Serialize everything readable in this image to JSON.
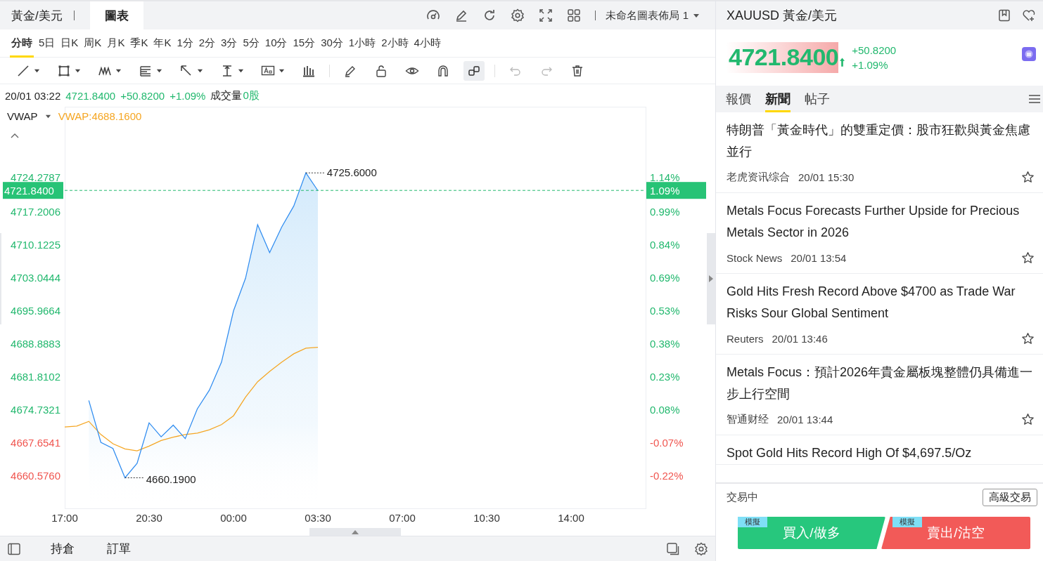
{
  "left_panel": {
    "tabs": [
      {
        "label": "黃金/美元",
        "selected": false
      },
      {
        "label": "圖表",
        "selected": true
      }
    ],
    "layout_menu": {
      "label": "未命名圖表佈局 1"
    },
    "periods": [
      {
        "label": "分時",
        "selected": true
      },
      {
        "label": "5日",
        "selected": false
      },
      {
        "label": "日K",
        "selected": false
      },
      {
        "label": "周K",
        "selected": false
      },
      {
        "label": "月K",
        "selected": false
      },
      {
        "label": "季K",
        "selected": false
      },
      {
        "label": "年K",
        "selected": false
      },
      {
        "label": "1分",
        "selected": false
      },
      {
        "label": "2分",
        "selected": false
      },
      {
        "label": "3分",
        "selected": false
      },
      {
        "label": "5分",
        "selected": false
      },
      {
        "label": "10分",
        "selected": false
      },
      {
        "label": "15分",
        "selected": false
      },
      {
        "label": "30分",
        "selected": false
      },
      {
        "label": "1小時",
        "selected": false
      },
      {
        "label": "2小時",
        "selected": false
      },
      {
        "label": "4小時",
        "selected": false
      }
    ],
    "info_bar": {
      "datetime": "20/01 03:22",
      "price": "4721.8400",
      "change": "+50.8200",
      "change_pct": "+1.09%",
      "volume_label": "成交量",
      "volume": "0股"
    },
    "chart": {
      "indicator": "VWAP",
      "indicator_value": "VWAP:4688.1600",
      "current_price": "4721.8400",
      "current_pct": "1.09%",
      "high_label": "4725.6000",
      "low_label": "4660.1900",
      "percent_axis": [
        {
          "label": "1.14%",
          "color": "#22b86e"
        },
        {
          "label": "0.99%",
          "color": "#22b86e"
        },
        {
          "label": "0.84%",
          "color": "#22b86e"
        },
        {
          "label": "0.69%",
          "color": "#22b86e"
        },
        {
          "label": "0.53%",
          "color": "#22b86e"
        },
        {
          "label": "0.38%",
          "color": "#22b86e"
        },
        {
          "label": "0.23%",
          "color": "#22b86e"
        },
        {
          "label": "0.08%",
          "color": "#22b86e"
        },
        {
          "label": "-0.07%",
          "color": "#f0554f"
        },
        {
          "label": "-0.22%",
          "color": "#f0554f"
        }
      ],
      "chart_data": {
        "type": "line",
        "ylim": [
          4653.65,
          4739.64
        ],
        "categories": [
          "17:00",
          null,
          null,
          null,
          null,
          null,
          null,
          "20:30",
          null,
          null,
          null,
          null,
          null,
          null,
          "00:00",
          null,
          null,
          null,
          null,
          null,
          null,
          "03:30",
          null,
          null,
          null,
          null,
          null,
          null,
          "07:00",
          null,
          null,
          null,
          null,
          null,
          null,
          "10:30",
          null,
          null,
          null,
          null,
          null,
          null,
          "14:00",
          null,
          null,
          null,
          null,
          null,
          null
        ],
        "yticks": [
          {
            "value": 4724.2787,
            "label": "4724.2787"
          },
          {
            "value": 4717.2006,
            "label": "4717.2006"
          },
          {
            "value": 4710.1225,
            "label": "4710.1225"
          },
          {
            "value": 4703.0444,
            "label": "4703.0444"
          },
          {
            "value": 4695.9664,
            "label": "4695.9664"
          },
          {
            "value": 4688.8883,
            "label": "4688.8883"
          },
          {
            "value": 4681.8102,
            "label": "4681.8102"
          },
          {
            "value": 4674.7321,
            "label": "4674.7321"
          },
          {
            "value": 4667.6541,
            "label": "4667.6541"
          },
          {
            "value": 4660.576,
            "label": "4660.5760"
          }
        ],
        "ref_lines": [
          {
            "axis": "y",
            "value": 4721.84,
            "color": "#22b86e"
          }
        ],
        "series": [
          {
            "color": "#2f8cf0",
            "values": [
              null,
              null,
              4676.8,
              4667.8,
              4666.5,
              4660.2,
              4663.3,
              4672.0,
              4669.0,
              4671.5,
              4668.6,
              4675.0,
              4679.0,
              4685.0,
              4696.0,
              4703.0,
              4714.5,
              4708.5,
              4714.0,
              4718.5,
              4725.6,
              4721.8,
              null,
              null,
              null,
              null,
              null,
              null,
              null,
              null,
              null,
              null,
              null,
              null,
              null,
              null,
              null,
              null,
              null,
              null,
              null,
              null,
              null,
              null,
              null,
              null,
              null,
              null,
              null
            ]
          },
          {
            "color": "#f5a623",
            "values": [
              4671.1,
              4671.3,
              4672.3,
              4669.5,
              4667.5,
              4666.4,
              4666.0,
              4667.0,
              4668.2,
              4668.9,
              4669.5,
              4669.8,
              4670.5,
              4671.6,
              4673.5,
              4677.5,
              4680.8,
              4683.0,
              4685.0,
              4686.8,
              4688.0,
              4688.2,
              null,
              null,
              null,
              null,
              null,
              null,
              null,
              null,
              null,
              null,
              null,
              null,
              null,
              null,
              null,
              null,
              null,
              null,
              null,
              null,
              null,
              null,
              null,
              null,
              null,
              null,
              null
            ]
          }
        ]
      }
    },
    "bottom_tabs": [
      "持倉",
      "訂單"
    ]
  },
  "right_panel": {
    "title": "XAUUSD 黃金/美元",
    "quote": {
      "price": "4721.8400",
      "change": "+50.8200",
      "change_pct": "+1.09%"
    },
    "tabs": [
      {
        "label": "報價",
        "selected": false
      },
      {
        "label": "新聞",
        "selected": true
      },
      {
        "label": "帖子",
        "selected": false
      }
    ],
    "news": [
      {
        "title": "特朗普「黃金時代」的雙重定價：股市狂歡與黃金焦慮並行",
        "source": "老虎资讯综合",
        "time": "20/01 15:30",
        "starred": false
      },
      {
        "title": "Metals Focus Forecasts Further Upside for Precious Metals Sector in 2026",
        "source": "Stock News",
        "time": "20/01 13:54",
        "starred": false
      },
      {
        "title": "Gold Hits Fresh Record Above $4700 as Trade War Risks Sour Global Sentiment",
        "source": "Reuters",
        "time": "20/01 13:46",
        "starred": false
      },
      {
        "title": "Metals Focus：預計2026年貴金屬板塊整體仍具備進一步上行空間",
        "source": "智通财经",
        "time": "20/01 13:44",
        "starred": false
      },
      {
        "title": "Spot Gold Hits Record High Of $4,697.5/Oz"
      }
    ],
    "trading_status": "交易中",
    "advanced_button": "高級交易",
    "buy": {
      "label": "買入/做多",
      "badge": "模擬"
    },
    "sell": {
      "label": "賣出/沽空",
      "badge": "模擬"
    }
  }
}
